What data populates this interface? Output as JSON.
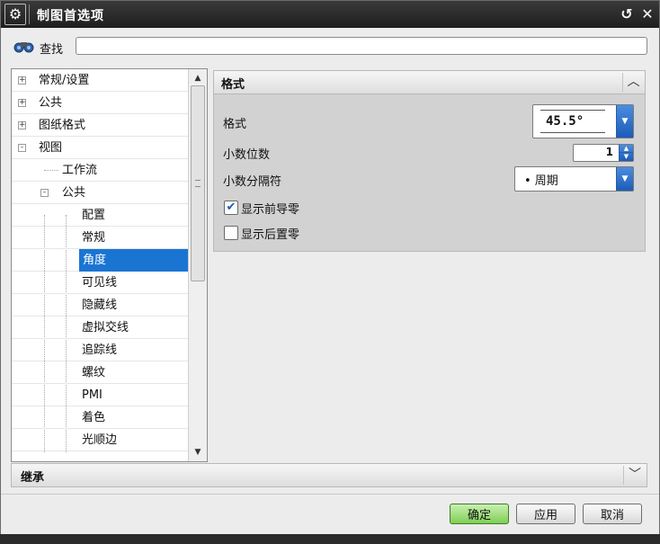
{
  "window": {
    "title": "制图首选项",
    "icons": {
      "app": "gear-icon",
      "reset": "reset-icon",
      "close": "close-icon"
    }
  },
  "search": {
    "label": "查找",
    "value": "",
    "icon": "binoculars-icon"
  },
  "tree": {
    "items": [
      {
        "label": "常规/设置",
        "toggle": "+"
      },
      {
        "label": "公共",
        "toggle": "+"
      },
      {
        "label": "图纸格式",
        "toggle": "+"
      },
      {
        "label": "视图",
        "toggle": "-"
      },
      {
        "label": "工作流",
        "toggle": ""
      },
      {
        "label": "公共",
        "toggle": "-"
      },
      {
        "label": "配置",
        "toggle": ""
      },
      {
        "label": "常规",
        "toggle": ""
      },
      {
        "label": "角度",
        "toggle": "",
        "selected": true
      },
      {
        "label": "可见线",
        "toggle": ""
      },
      {
        "label": "隐藏线",
        "toggle": ""
      },
      {
        "label": "虚拟交线",
        "toggle": ""
      },
      {
        "label": "追踪线",
        "toggle": ""
      },
      {
        "label": "螺纹",
        "toggle": ""
      },
      {
        "label": "PMI",
        "toggle": ""
      },
      {
        "label": "着色",
        "toggle": ""
      },
      {
        "label": "光顺边",
        "toggle": ""
      }
    ],
    "scroll_up": "▲",
    "scroll_down": "▼"
  },
  "section": {
    "title": "格式",
    "collapse_glyph": "︿",
    "format_label": "格式",
    "format_value": "45.5°",
    "decimal_places_label": "小数位数",
    "decimal_places_value": "1",
    "separator_label": "小数分隔符",
    "separator_value": "• 周期",
    "show_leading_zeros": {
      "label": "显示前导零",
      "checked": true
    },
    "show_trailing_zeros": {
      "label": "显示后置零",
      "checked": false
    }
  },
  "inherit": {
    "title": "继承",
    "expand_glyph": "﹀"
  },
  "buttons": {
    "ok": "确定",
    "apply": "应用",
    "cancel": "取消"
  },
  "colors": {
    "selection": "#1a75d2",
    "combo_arrow": "#1a5cb8",
    "ok_button": "#7fcf55",
    "titlebar": "#1e1e1e"
  }
}
